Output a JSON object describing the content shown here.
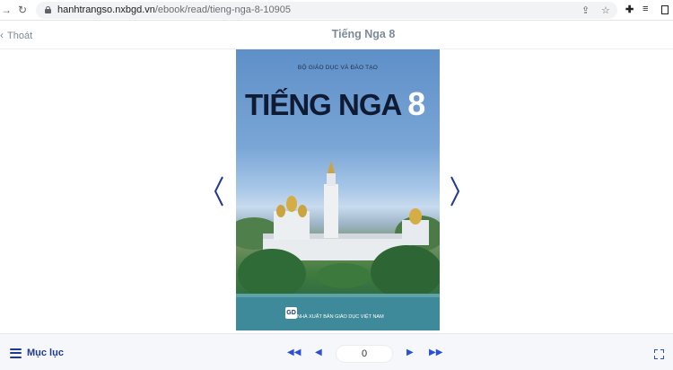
{
  "browser": {
    "url_domain": "hanhtrangso.nxbgd.vn",
    "url_path": "/ebook/read/tieng-nga-8-10905",
    "icons": [
      "back-icon",
      "reload-icon",
      "lock-icon",
      "share-icon",
      "star-icon",
      "extensions-icon",
      "reading-list-icon",
      "sidebar-icon"
    ]
  },
  "header": {
    "back_label": "Thoát",
    "title": "Tiếng Nga 8"
  },
  "cover": {
    "publisher_top": "BỘ GIÁO DỤC VÀ ĐÀO TẠO",
    "title_text": "TIẾNG NGA",
    "title_number": "8",
    "logo_text": "GD",
    "publisher_bottom": "NHÀ XUẤT BẢN GIÁO DỤC VIỆT NAM"
  },
  "toolbar": {
    "menu_label": "Mục lục",
    "page_value": "0"
  },
  "colors": {
    "accent": "#2c4fd6",
    "header_text": "#7d8a9a",
    "arrow": "#1f3a93"
  }
}
